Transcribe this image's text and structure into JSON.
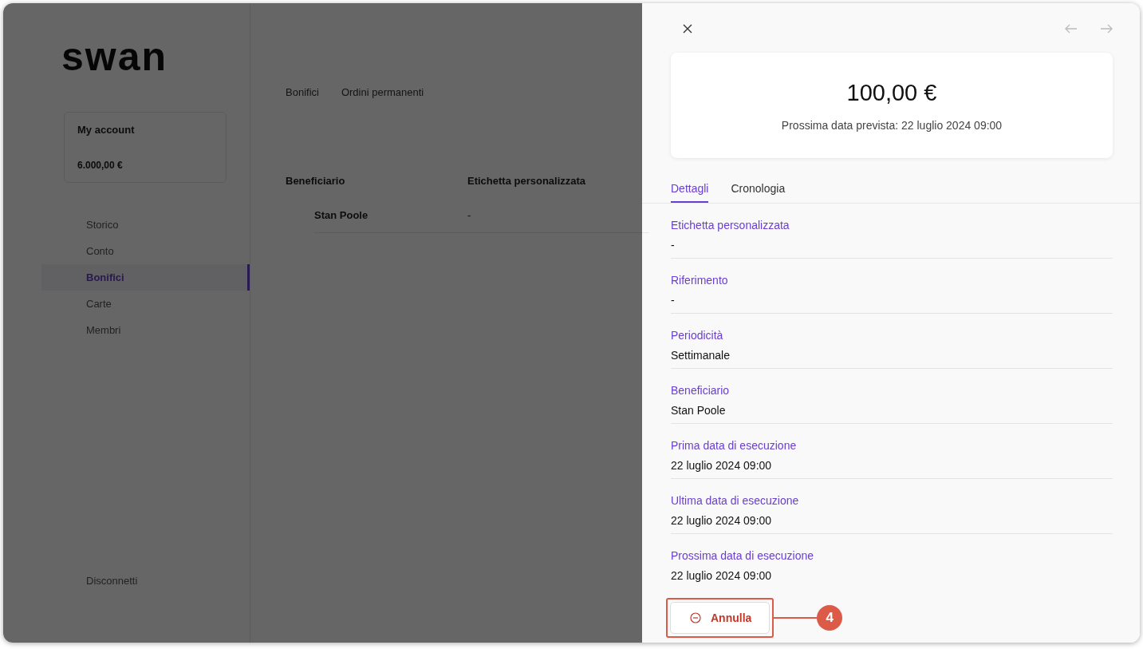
{
  "background": {
    "logo": "swan",
    "account": {
      "name": "My account",
      "balance": "6.000,00 €"
    },
    "nav": [
      {
        "label": "Storico",
        "selected": false
      },
      {
        "label": "Conto",
        "selected": false
      },
      {
        "label": "Bonifici",
        "selected": true
      },
      {
        "label": "Carte",
        "selected": false
      },
      {
        "label": "Membri",
        "selected": false
      }
    ],
    "logout": "Disconnetti",
    "tabs": [
      "Bonifici",
      "Ordini permanenti"
    ],
    "columns": [
      "Beneficiario",
      "Etichetta personalizzata"
    ],
    "rows": [
      [
        "Stan Poole",
        "-"
      ]
    ]
  },
  "panel": {
    "amount": "100,00 €",
    "next_date": "Prossima data prevista: 22 luglio 2024 09:00",
    "tabs": [
      {
        "label": "Dettagli",
        "selected": true
      },
      {
        "label": "Cronologia",
        "selected": false
      }
    ],
    "fields": [
      {
        "label": "Etichetta personalizzata",
        "value": "-"
      },
      {
        "label": "Riferimento",
        "value": "-"
      },
      {
        "label": "Periodicità",
        "value": "Settimanale"
      },
      {
        "label": "Beneficiario",
        "value": "Stan Poole"
      },
      {
        "label": "Prima data di esecuzione",
        "value": "22 luglio 2024 09:00"
      },
      {
        "label": "Ultima data di esecuzione",
        "value": "22 luglio 2024 09:00"
      },
      {
        "label": "Prossima data di esecuzione",
        "value": "22 luglio 2024 09:00"
      }
    ],
    "cancel_button": "Annulla"
  },
  "callout": {
    "number": "4"
  }
}
